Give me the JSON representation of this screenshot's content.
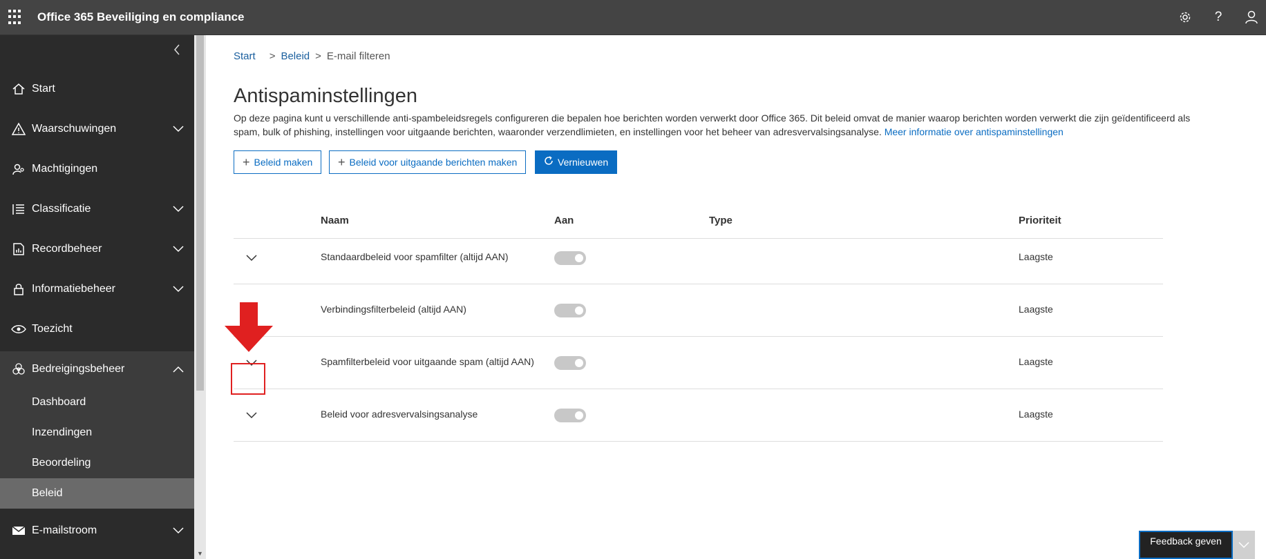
{
  "app": {
    "title": "Office 365 Beveiliging en compliance"
  },
  "sidebar": {
    "items": [
      {
        "label": "Start",
        "icon": "home-icon"
      },
      {
        "label": "Waarschuwingen",
        "icon": "warning-icon"
      },
      {
        "label": "Machtigingen",
        "icon": "permissions-icon"
      },
      {
        "label": "Classificatie",
        "icon": "list-icon"
      },
      {
        "label": "Recordbeheer",
        "icon": "records-icon"
      },
      {
        "label": "Informatiebeheer",
        "icon": "lock-icon"
      },
      {
        "label": "Toezicht",
        "icon": "eye-icon"
      },
      {
        "label": "Bedreigingsbeheer",
        "icon": "biohazard-icon"
      },
      {
        "label": "E-mailstroom",
        "icon": "mail-icon"
      }
    ],
    "subitems": [
      {
        "label": "Dashboard"
      },
      {
        "label": "Inzendingen"
      },
      {
        "label": "Beoordeling"
      },
      {
        "label": "Beleid"
      }
    ]
  },
  "breadcrumb": {
    "start": "Start",
    "sep1": ">",
    "beleid": "Beleid",
    "sep2": ">",
    "current": "E-mail filteren"
  },
  "page": {
    "title": "Antispaminstellingen",
    "description": "Op deze pagina kunt u verschillende anti-spambeleidsregels configureren die bepalen hoe berichten worden verwerkt door Office 365. Dit beleid omvat de manier waarop berichten worden verwerkt die zijn geïdentificeerd als spam, bulk of phishing, instellingen voor uitgaande berichten, waaronder verzendlimieten, en instellingen voor het beheer van adresvervalsingsanalyse.",
    "link": "Meer informatie over antispaminstellingen"
  },
  "toolbar": {
    "create": "Beleid maken",
    "create_outbound": "Beleid voor uitgaande berichten maken",
    "refresh": "Vernieuwen"
  },
  "table": {
    "headers": {
      "name": "Naam",
      "on": "Aan",
      "type": "Type",
      "priority": "Prioriteit"
    },
    "rows": [
      {
        "name": "Standaardbeleid voor spamfilter (altijd AAN)",
        "priority": "Laagste"
      },
      {
        "name": "Verbindingsfilterbeleid (altijd AAN)",
        "priority": "Laagste"
      },
      {
        "name": "Spamfilterbeleid voor uitgaande spam (altijd AAN)",
        "priority": "Laagste"
      },
      {
        "name": "Beleid voor adresvervalsingsanalyse",
        "priority": "Laagste"
      }
    ]
  },
  "feedback": {
    "label": "Feedback geven"
  },
  "colors": {
    "accent": "#0a6cc2",
    "topbar": "#444444",
    "sidebar": "#2b2b2b",
    "annotation": "#e02020"
  }
}
